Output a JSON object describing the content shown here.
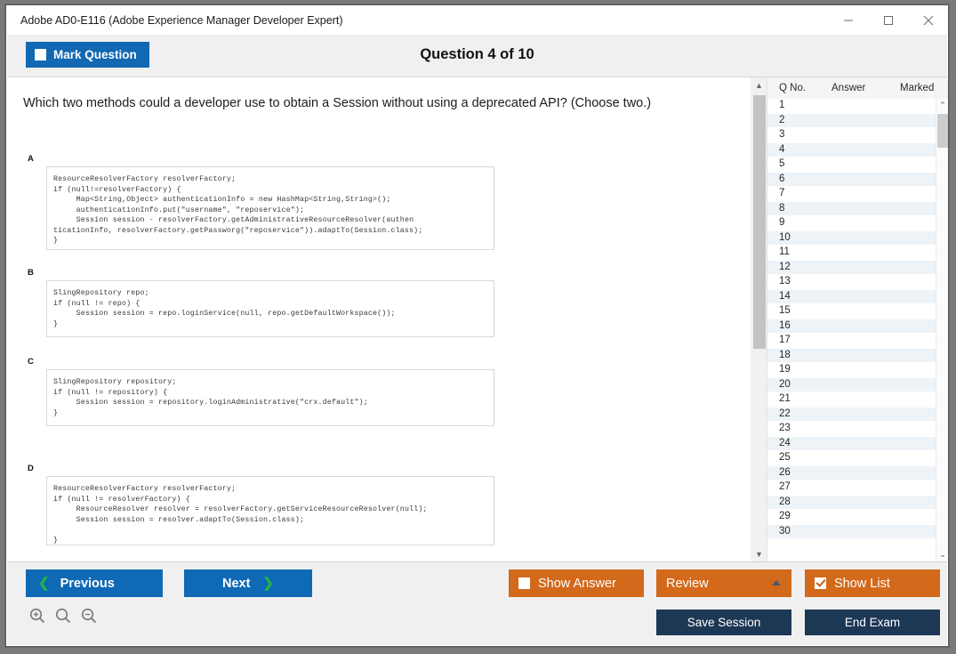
{
  "window": {
    "title": "Adobe AD0-E116 (Adobe Experience Manager Developer Expert)",
    "minimize_label": "minimize",
    "maximize_label": "maximize",
    "close_label": "close"
  },
  "header": {
    "mark_question_label": "Mark Question",
    "mark_question_checked": false,
    "question_title": "Question 4 of 10"
  },
  "question": {
    "text": "Which two methods could a developer use to obtain a Session without using a deprecated API? (Choose two.)",
    "options": [
      {
        "letter": "A",
        "code": "ResourceResolverFactory resolverFactory;\nif (null!=resolverFactory) {\n     Map<String,Object> authenticationInfo = new HashMap<String,String>();\n     authenticationInfo.put(\"username\", \"reposervice\");\n     Session session - resolverFactory.getAdministrativeResourceResolver(authen\nticationInfo, resolverFactory.getPassworg(\"reposervice\")).adaptTo(Session.class);\n}"
      },
      {
        "letter": "B",
        "code": "SlingRepository repo;\nif (null != repo) {\n     Session session = repo.loginService(null, repo.getDefaultWorkspace());\n}"
      },
      {
        "letter": "C",
        "code": "SlingRepository repository;\nif (null != repository) {\n     Session session = repository.loginAdministrative(\"crx.default\");\n}"
      },
      {
        "letter": "D",
        "code": "ResourceResolverFactory resolverFactory;\nif (null != resolverFactory) {\n     ResourceResolver resolver = resolverFactory.getServiceResourceResolver(null);\n     Session session = resolver.adaptTo(Session.class);\n\n}"
      }
    ]
  },
  "question_list": {
    "columns": [
      "Q No.",
      "Answer",
      "Marked"
    ],
    "rows": [
      {
        "no": "1",
        "answer": "",
        "marked": ""
      },
      {
        "no": "2",
        "answer": "",
        "marked": ""
      },
      {
        "no": "3",
        "answer": "",
        "marked": ""
      },
      {
        "no": "4",
        "answer": "",
        "marked": ""
      },
      {
        "no": "5",
        "answer": "",
        "marked": ""
      },
      {
        "no": "6",
        "answer": "",
        "marked": ""
      },
      {
        "no": "7",
        "answer": "",
        "marked": ""
      },
      {
        "no": "8",
        "answer": "",
        "marked": ""
      },
      {
        "no": "9",
        "answer": "",
        "marked": ""
      },
      {
        "no": "10",
        "answer": "",
        "marked": ""
      },
      {
        "no": "11",
        "answer": "",
        "marked": ""
      },
      {
        "no": "12",
        "answer": "",
        "marked": ""
      },
      {
        "no": "13",
        "answer": "",
        "marked": ""
      },
      {
        "no": "14",
        "answer": "",
        "marked": ""
      },
      {
        "no": "15",
        "answer": "",
        "marked": ""
      },
      {
        "no": "16",
        "answer": "",
        "marked": ""
      },
      {
        "no": "17",
        "answer": "",
        "marked": ""
      },
      {
        "no": "18",
        "answer": "",
        "marked": ""
      },
      {
        "no": "19",
        "answer": "",
        "marked": ""
      },
      {
        "no": "20",
        "answer": "",
        "marked": ""
      },
      {
        "no": "21",
        "answer": "",
        "marked": ""
      },
      {
        "no": "22",
        "answer": "",
        "marked": ""
      },
      {
        "no": "23",
        "answer": "",
        "marked": ""
      },
      {
        "no": "24",
        "answer": "",
        "marked": ""
      },
      {
        "no": "25",
        "answer": "",
        "marked": ""
      },
      {
        "no": "26",
        "answer": "",
        "marked": ""
      },
      {
        "no": "27",
        "answer": "",
        "marked": ""
      },
      {
        "no": "28",
        "answer": "",
        "marked": ""
      },
      {
        "no": "29",
        "answer": "",
        "marked": ""
      },
      {
        "no": "30",
        "answer": "",
        "marked": ""
      }
    ]
  },
  "footer": {
    "previous_label": "Previous",
    "next_label": "Next",
    "show_answer_label": "Show Answer",
    "show_answer_checked": false,
    "review_label": "Review",
    "show_list_label": "Show List",
    "show_list_checked": true,
    "save_session_label": "Save Session",
    "end_exam_label": "End Exam",
    "zoom_in_label": "zoom-in",
    "zoom_reset_label": "zoom-reset",
    "zoom_out_label": "zoom-out"
  },
  "colors": {
    "accent_blue": "#0f69b4",
    "accent_orange": "#d2691b",
    "accent_navy": "#1d3855",
    "chevron_green": "#22b14c",
    "row_alt": "#eef3f8"
  }
}
